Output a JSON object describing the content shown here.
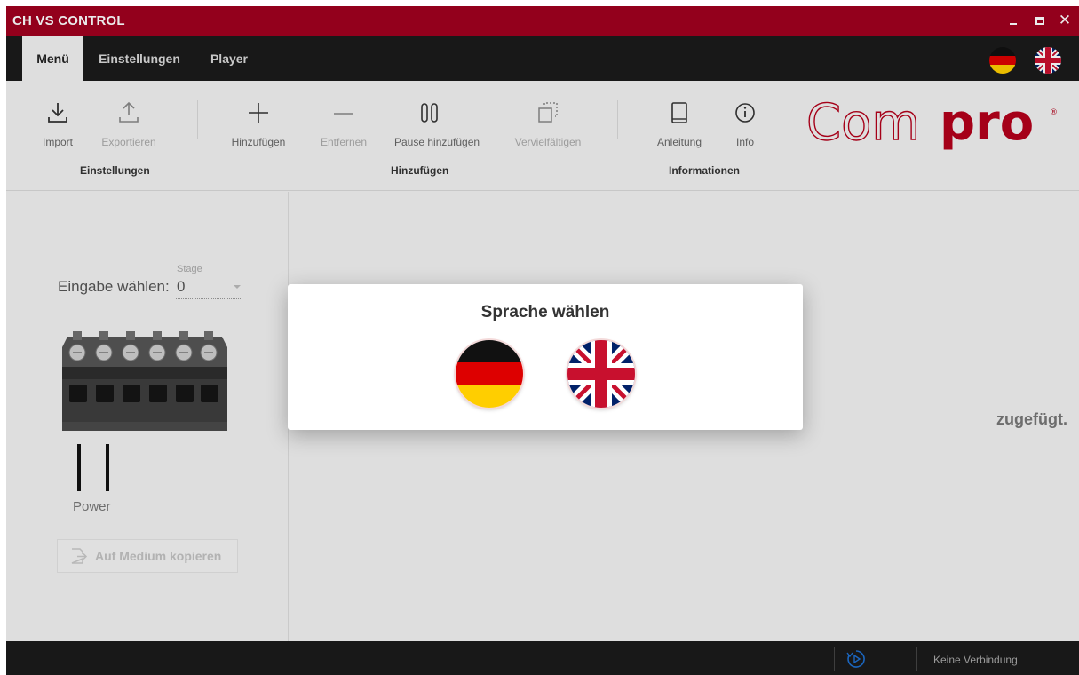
{
  "window": {
    "title": "CH VS CONTROL"
  },
  "tabs": {
    "menu": "Menü",
    "settings": "Einstellungen",
    "player": "Player"
  },
  "ribbon": {
    "import": "Import",
    "export": "Exportieren",
    "add": "Hinzufügen",
    "remove": "Entfernen",
    "add_pause": "Pause hinzufügen",
    "duplicate": "Vervielfältigen",
    "manual": "Anleitung",
    "info": "Info",
    "group_settings": "Einstellungen",
    "group_add": "Hinzufügen",
    "group_info": "Informationen"
  },
  "logo": {
    "text_light": "Com",
    "text_bold": "pro",
    "mark": "®"
  },
  "left_panel": {
    "stage_label": "Stage",
    "input_label": "Eingabe wählen:",
    "input_value": "0",
    "power_label": "Power",
    "copy_button": "Auf Medium kopieren"
  },
  "main": {
    "empty_message": "zugefügt."
  },
  "status": {
    "connection": "Keine Verbindung"
  },
  "dialog": {
    "title": "Sprache wählen"
  },
  "colors": {
    "accent": "#a0001f",
    "dark": "#1b1b1b",
    "panel": "#f1f1f1"
  },
  "icons": [
    "download-icon",
    "upload-icon",
    "plus-icon",
    "minus-icon",
    "pause-icon",
    "duplicate-icon",
    "book-icon",
    "info-icon",
    "german-flag-icon",
    "uk-flag-icon",
    "file-arrow-icon",
    "play-refresh-icon"
  ]
}
